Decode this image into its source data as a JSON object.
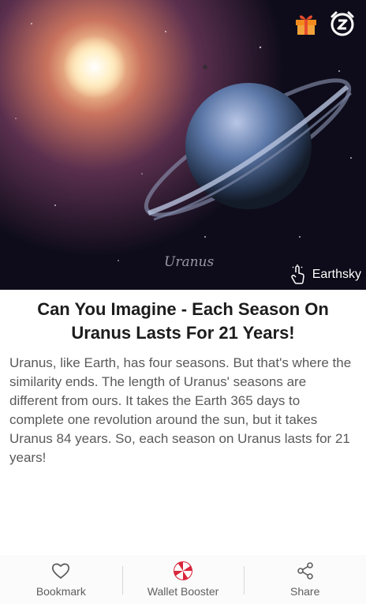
{
  "hero": {
    "image_caption": "Uranus",
    "source_label": "Earthsky",
    "top_icons": [
      "gift-icon",
      "snooze-alarm-icon"
    ]
  },
  "article": {
    "title": "Can You Imagine - Each Season On Uranus Lasts For 21 Years!",
    "body": "Uranus, like Earth, has four seasons. But that's where the similarity ends. The length of Uranus' seasons are different from ours. It takes the Earth 365 days to complete one revolution around the sun, but it takes Uranus 84 years. So, each season on Uranus lasts for 21 years!"
  },
  "bottom_bar": {
    "bookmark_label": "Bookmark",
    "wallet_label": "Wallet Booster",
    "share_label": "Share"
  },
  "colors": {
    "wallet_accent": "#d9263c",
    "gift_orange": "#f28a1e"
  }
}
